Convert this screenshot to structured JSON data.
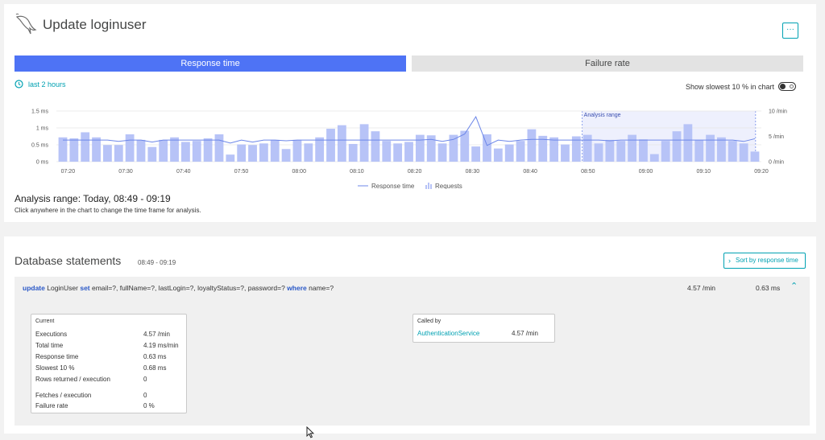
{
  "header": {
    "title": "Update loginuser",
    "more_label": "···"
  },
  "tabs": [
    {
      "label": "Response time",
      "active": true
    },
    {
      "label": "Failure rate",
      "active": false
    }
  ],
  "timeframe": {
    "label": "last 2 hours",
    "icon": "clock-icon"
  },
  "toggle": {
    "label": "Show slowest 10 % in chart",
    "on": false
  },
  "chart_data": {
    "type": "bar",
    "title": "",
    "left_axis": {
      "ticks": [
        "0 ms",
        "0.5 ms",
        "1 ms",
        "1.5 ms"
      ],
      "range": [
        0,
        1.5
      ],
      "unit": "ms"
    },
    "right_axis": {
      "ticks": [
        "0 /min",
        "5 /min",
        "10 /min"
      ],
      "range": [
        0,
        10
      ],
      "unit": "/min"
    },
    "x_ticks": [
      "07:20",
      "07:30",
      "07:40",
      "07:50",
      "08:00",
      "08:10",
      "08:20",
      "08:30",
      "08:40",
      "08:50",
      "09:00",
      "09:10",
      "09:20"
    ],
    "x_range_minutes": [
      438,
      560
    ],
    "series": [
      {
        "name": "Requests",
        "kind": "bar",
        "values": [
          4.8,
          4.6,
          5.8,
          4.8,
          3.3,
          3.3,
          5.4,
          4.3,
          2.9,
          4.3,
          4.8,
          3.9,
          4.1,
          4.6,
          5.4,
          1.4,
          3.4,
          3.3,
          3.6,
          4.3,
          2.5,
          4.3,
          3.6,
          4.8,
          6.5,
          7.2,
          3.5,
          7.4,
          6.0,
          4.1,
          3.6,
          3.9,
          5.3,
          5.2,
          3.6,
          5.3,
          6.1,
          3.0,
          5.4,
          2.6,
          3.4,
          4.1,
          6.4,
          5.1,
          4.8,
          3.4,
          5.0,
          5.3,
          3.6,
          4.3,
          4.1,
          5.3,
          4.4,
          1.5,
          4.1,
          6.0,
          7.4,
          4.3,
          5.3,
          4.8,
          4.1,
          3.6,
          2.0
        ],
        "color": "#b7c3f7"
      },
      {
        "name": "Response time",
        "kind": "line",
        "values": [
          0.64,
          0.64,
          0.64,
          0.64,
          0.64,
          0.6,
          0.64,
          0.64,
          0.58,
          0.64,
          0.64,
          0.64,
          0.64,
          0.64,
          0.64,
          0.55,
          0.64,
          0.58,
          0.64,
          0.64,
          0.62,
          0.64,
          0.64,
          0.64,
          0.64,
          0.64,
          0.64,
          0.64,
          0.64,
          0.64,
          0.64,
          0.64,
          0.64,
          0.66,
          0.6,
          0.66,
          0.82,
          1.33,
          0.48,
          0.64,
          0.6,
          0.64,
          0.66,
          0.66,
          0.64,
          0.64,
          0.64,
          0.64,
          0.64,
          0.62,
          0.64,
          0.64,
          0.64,
          0.64,
          0.64,
          0.64,
          0.64,
          0.64,
          0.64,
          0.64,
          0.64,
          0.6,
          0.68
        ],
        "color": "#6d87e8"
      }
    ],
    "analysis_range_label": "Analysis range",
    "analysis_range": [
      "08:49",
      "09:19"
    ],
    "legend": [
      {
        "label": "Response time",
        "kind": "line"
      },
      {
        "label": "Requests",
        "kind": "bar"
      }
    ],
    "legend_position": "bottom",
    "grid": true
  },
  "analysis": {
    "title": "Analysis range: Today, 08:49 - 09:19",
    "hint": "Click anywhere in the chart to change the time frame for analysis."
  },
  "db": {
    "title": "Database statements",
    "range": "08:49 - 09:19",
    "sort_label": "Sort by response time",
    "statement": {
      "kw_update": "update",
      "p1": " LoginUser ",
      "kw_set": "set",
      "p2": " email=?, fullName=?, lastLogin=?, loyaltyStatus=?, password=? ",
      "kw_where": "where",
      "p3": " name=?",
      "rate": "4.57 /min",
      "response": "0.63 ms"
    },
    "current": {
      "heading": "Current",
      "rows": [
        {
          "label": "Executions",
          "value": "4.57 /min"
        },
        {
          "label": "Total time",
          "value": "4.19 ms/min"
        },
        {
          "label": "Response time",
          "value": "0.63 ms"
        },
        {
          "label": "Slowest 10 %",
          "value": "0.68 ms"
        },
        {
          "label": "Rows returned / execution",
          "value": "0"
        },
        {
          "label": "Fetches / execution",
          "value": "0"
        },
        {
          "label": "Failure rate",
          "value": "0 %"
        }
      ]
    },
    "called_by": {
      "heading": "Called by",
      "service": "AuthenticationService",
      "rate": "4.57 /min"
    }
  },
  "colors": {
    "accent": "#4e73f5",
    "link": "#00a1b2",
    "bar": "#b7c3f7",
    "line": "#6d87e8",
    "analysis_fill": "#eef0fd"
  }
}
